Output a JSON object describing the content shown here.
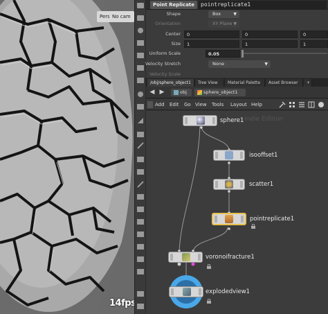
{
  "viewport": {
    "persp_label": "Persp",
    "cam_label": "No cam",
    "fps": "14fps"
  },
  "params": {
    "node_type": "Point Replicate",
    "node_name": "pointreplicate1",
    "rows": [
      {
        "label": "Shape",
        "type": "menu",
        "value": "Box",
        "dim": false
      },
      {
        "label": "Orientation",
        "type": "menu",
        "value": "XY Plane",
        "dim": true
      },
      {
        "label": "Center",
        "type": "vector",
        "values": [
          "0",
          "0",
          "0"
        ],
        "dim": false
      },
      {
        "label": "Size",
        "type": "vector",
        "values": [
          "1",
          "1",
          "1"
        ],
        "dim": false
      },
      {
        "label": "Uniform Scale",
        "type": "slider",
        "value": "0.05",
        "dim": false
      },
      {
        "label": "Velocity Stretch",
        "type": "menu",
        "value": "None",
        "dim": false
      },
      {
        "label": "Velocity Scale",
        "type": "text",
        "value": "",
        "dim": true
      }
    ]
  },
  "tabs": [
    {
      "label": "/obj/sphere_object1",
      "active": true
    },
    {
      "label": "Tree View",
      "active": false
    },
    {
      "label": "Material Palette",
      "active": false
    },
    {
      "label": "Asset Browser",
      "active": false
    }
  ],
  "pathbar": {
    "context": "obj",
    "object": "sphere_object1"
  },
  "menubar": {
    "items": [
      "Add",
      "Edit",
      "Go",
      "View",
      "Tools",
      "Layout",
      "Help"
    ]
  },
  "network": {
    "watermark": "Indie Edition",
    "nodes": [
      {
        "name": "sphere1",
        "icon": "sphere-icon"
      },
      {
        "name": "isooffset1",
        "icon": "isooffset-icon"
      },
      {
        "name": "scatter1",
        "icon": "scatter-icon"
      },
      {
        "name": "pointreplicate1",
        "icon": "pointreplicate-icon"
      },
      {
        "name": "voronoifracture1",
        "icon": "voronoi-icon"
      },
      {
        "name": "explodedview1",
        "icon": "explodedview-icon"
      }
    ]
  },
  "colors": {
    "selection_outline": "#e8c04a",
    "display_flag": "#4aa8e8",
    "voronoi_input_dot": "#e84ae0"
  }
}
